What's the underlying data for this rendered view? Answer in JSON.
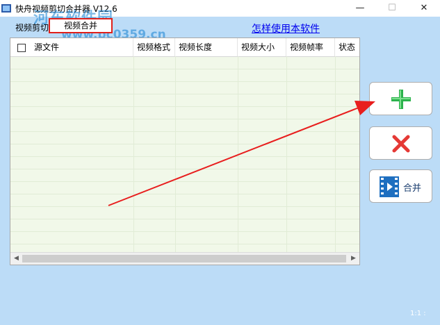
{
  "window": {
    "title": "快舟视频剪切合并器 V12.6",
    "minimize": "—",
    "maximize": "☐",
    "close": "✕"
  },
  "watermark": {
    "text": "河东软件园",
    "url": "www.pc0359.cn"
  },
  "tabs": [
    {
      "label": "视频剪切",
      "selected": false
    },
    {
      "label": "视频合并",
      "selected": true
    }
  ],
  "help_link": "怎样使用本软件",
  "table": {
    "columns": [
      "源文件",
      "视频格式",
      "视频长度",
      "视频大小",
      "视频帧率",
      "状态"
    ],
    "rows": []
  },
  "scrollbar": {
    "left_arrow": "◀",
    "right_arrow": "▶"
  },
  "side_buttons": {
    "add_icon": "plus-icon",
    "delete_icon": "x-icon",
    "merge_label": "合并"
  },
  "colors": {
    "accent_green": "#2bb24c",
    "delete_red": "#e53935",
    "highlight_red": "#e0201a",
    "background": "#bcdcf7"
  },
  "footer": "1:1 :"
}
